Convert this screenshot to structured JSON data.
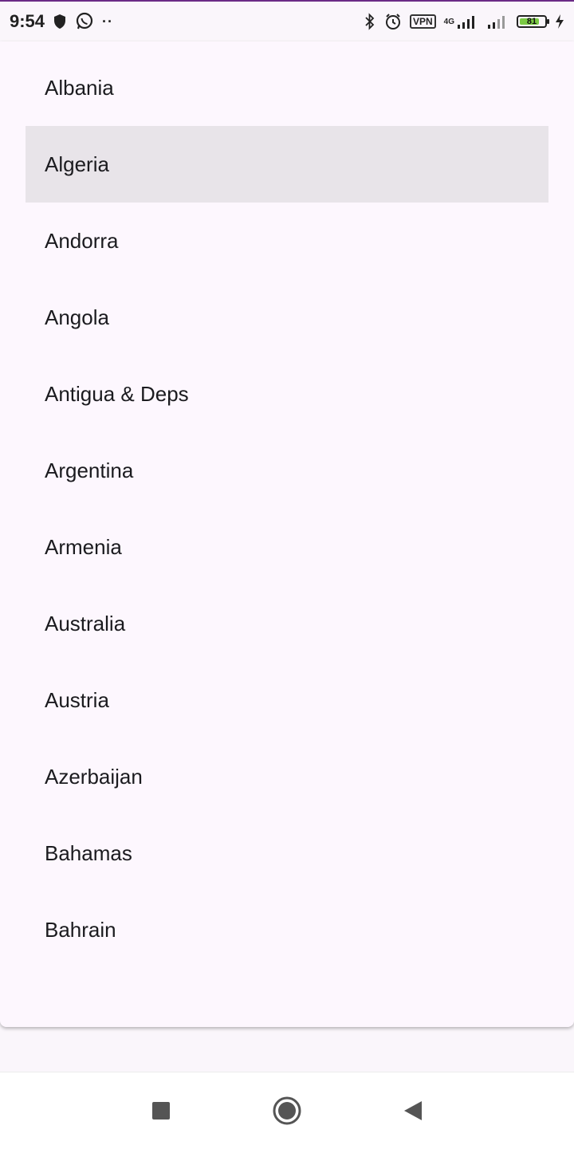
{
  "status_bar": {
    "time": "9:54",
    "dots": "··",
    "vpn": "VPN",
    "network": "4G",
    "battery": "81",
    "battery_level": 0.81
  },
  "country_list": {
    "items": [
      {
        "label": "Albania"
      },
      {
        "label": "Algeria"
      },
      {
        "label": "Andorra"
      },
      {
        "label": "Angola"
      },
      {
        "label": "Antigua & Deps"
      },
      {
        "label": "Argentina"
      },
      {
        "label": "Armenia"
      },
      {
        "label": "Australia"
      },
      {
        "label": "Austria"
      },
      {
        "label": "Azerbaijan"
      },
      {
        "label": "Bahamas"
      },
      {
        "label": "Bahrain"
      }
    ],
    "selected_index": 1
  },
  "nav_bar": {
    "icons": [
      "recents-icon",
      "home-icon",
      "back-icon"
    ]
  }
}
